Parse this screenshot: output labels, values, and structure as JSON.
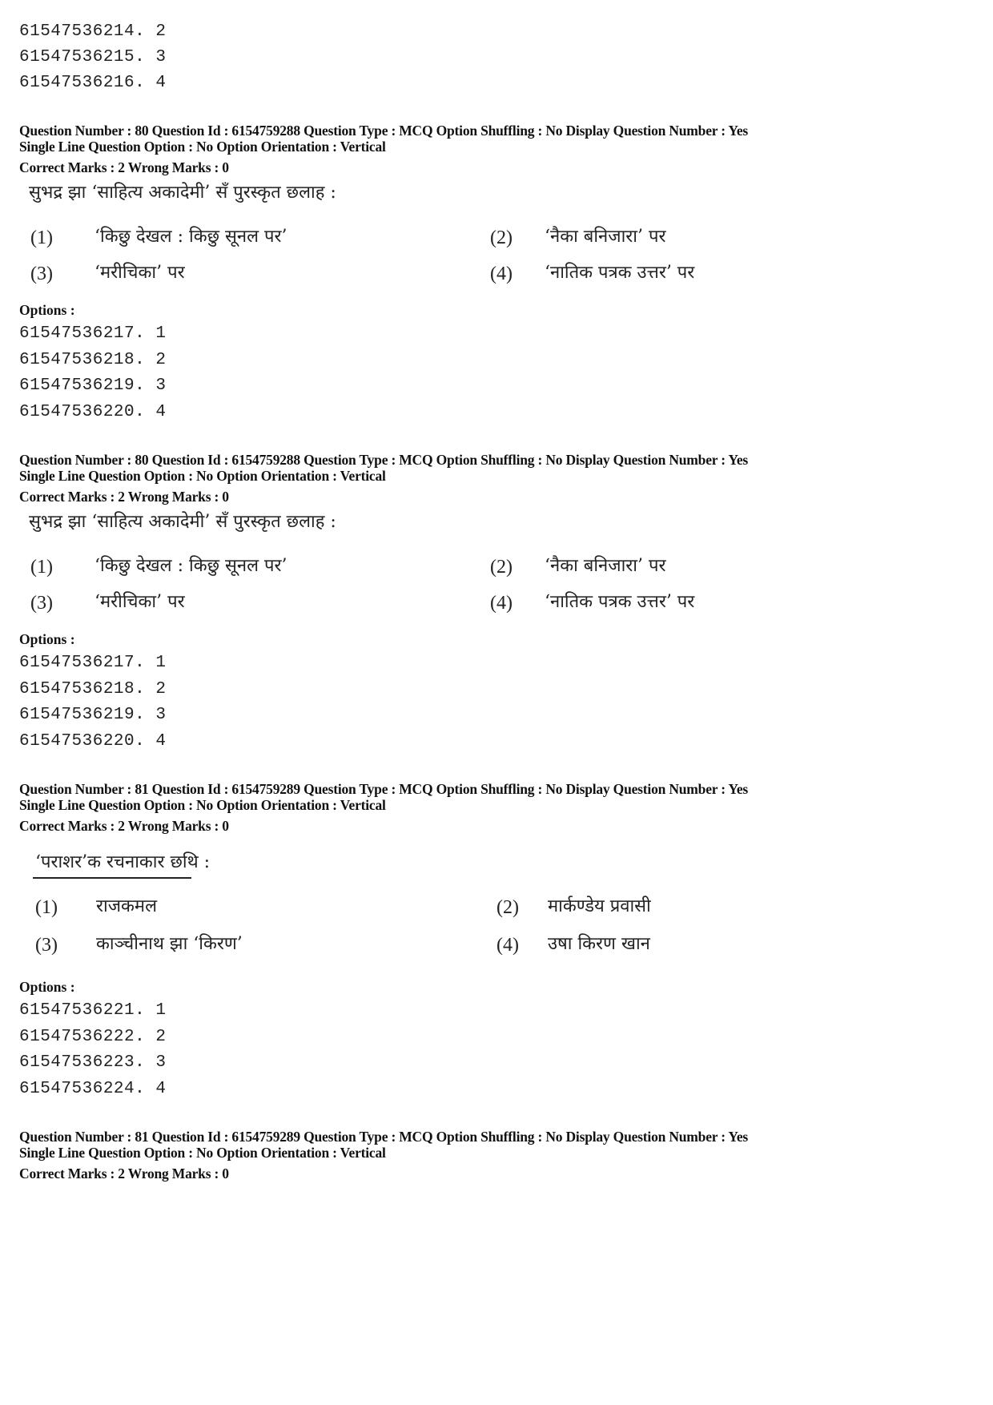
{
  "top_options": [
    {
      "id": "61547536214",
      "value": "2"
    },
    {
      "id": "61547536215",
      "value": "3"
    },
    {
      "id": "61547536216",
      "value": "4"
    }
  ],
  "questions": [
    {
      "meta_line1": "Question Number : 80  Question Id : 6154759288  Question Type : MCQ  Option Shuffling : No  Display Question Number : Yes",
      "meta_line2": "Single Line Question Option : No  Option Orientation : Vertical",
      "marks": "Correct Marks : 2  Wrong Marks : 0",
      "question_text": "सुभद्र झा ‘साहित्य अकादेमी’ सँ पुरस्कृत छलाह :",
      "choices": [
        {
          "num": "(1)",
          "text": "‘किछु देखल : किछु सूनल पर’"
        },
        {
          "num": "(2)",
          "text": "‘नैका बनिजारा’ पर"
        },
        {
          "num": "(3)",
          "text": "‘मरीचिका’ पर"
        },
        {
          "num": "(4)",
          "text": "‘नातिक पत्रक उत्तर’ पर"
        }
      ],
      "options_label": "Options :",
      "options": [
        {
          "id": "61547536217",
          "value": "1"
        },
        {
          "id": "61547536218",
          "value": "2"
        },
        {
          "id": "61547536219",
          "value": "3"
        },
        {
          "id": "61547536220",
          "value": "4"
        }
      ]
    },
    {
      "meta_line1": "Question Number : 80  Question Id : 6154759288  Question Type : MCQ  Option Shuffling : No  Display Question Number : Yes",
      "meta_line2": "Single Line Question Option : No  Option Orientation : Vertical",
      "marks": "Correct Marks : 2  Wrong Marks : 0",
      "question_text": "सुभद्र झा ‘साहित्य अकादेमी’ सँ पुरस्कृत छलाह :",
      "choices": [
        {
          "num": "(1)",
          "text": "‘किछु देखल : किछु सूनल पर’"
        },
        {
          "num": "(2)",
          "text": "‘नैका बनिजारा’ पर"
        },
        {
          "num": "(3)",
          "text": "‘मरीचिका’ पर"
        },
        {
          "num": "(4)",
          "text": "‘नातिक पत्रक उत्तर’ पर"
        }
      ],
      "options_label": "Options :",
      "options": [
        {
          "id": "61547536217",
          "value": "1"
        },
        {
          "id": "61547536218",
          "value": "2"
        },
        {
          "id": "61547536219",
          "value": "3"
        },
        {
          "id": "61547536220",
          "value": "4"
        }
      ]
    },
    {
      "meta_line1": "Question Number : 81  Question Id : 6154759289  Question Type : MCQ  Option Shuffling : No  Display Question Number : Yes",
      "meta_line2": "Single Line Question Option : No  Option Orientation : Vertical",
      "marks": "Correct Marks : 2  Wrong Marks : 0",
      "question_text": "‘पराशर’क रचनाकार छथि :",
      "choices": [
        {
          "num": "(1)",
          "text": "राजकमल"
        },
        {
          "num": "(2)",
          "text": "मार्कण्डेय प्रवासी"
        },
        {
          "num": "(3)",
          "text": "काञ्चीनाथ झा ‘किरण’"
        },
        {
          "num": "(4)",
          "text": "उषा किरण खान"
        }
      ],
      "options_label": "Options :",
      "options": [
        {
          "id": "61547536221",
          "value": "1"
        },
        {
          "id": "61547536222",
          "value": "2"
        },
        {
          "id": "61547536223",
          "value": "3"
        },
        {
          "id": "61547536224",
          "value": "4"
        }
      ]
    },
    {
      "meta_line1": "Question Number : 81  Question Id : 6154759289  Question Type : MCQ  Option Shuffling : No  Display Question Number : Yes",
      "meta_line2": "Single Line Question Option : No  Option Orientation : Vertical",
      "marks": "Correct Marks : 2  Wrong Marks : 0"
    }
  ]
}
